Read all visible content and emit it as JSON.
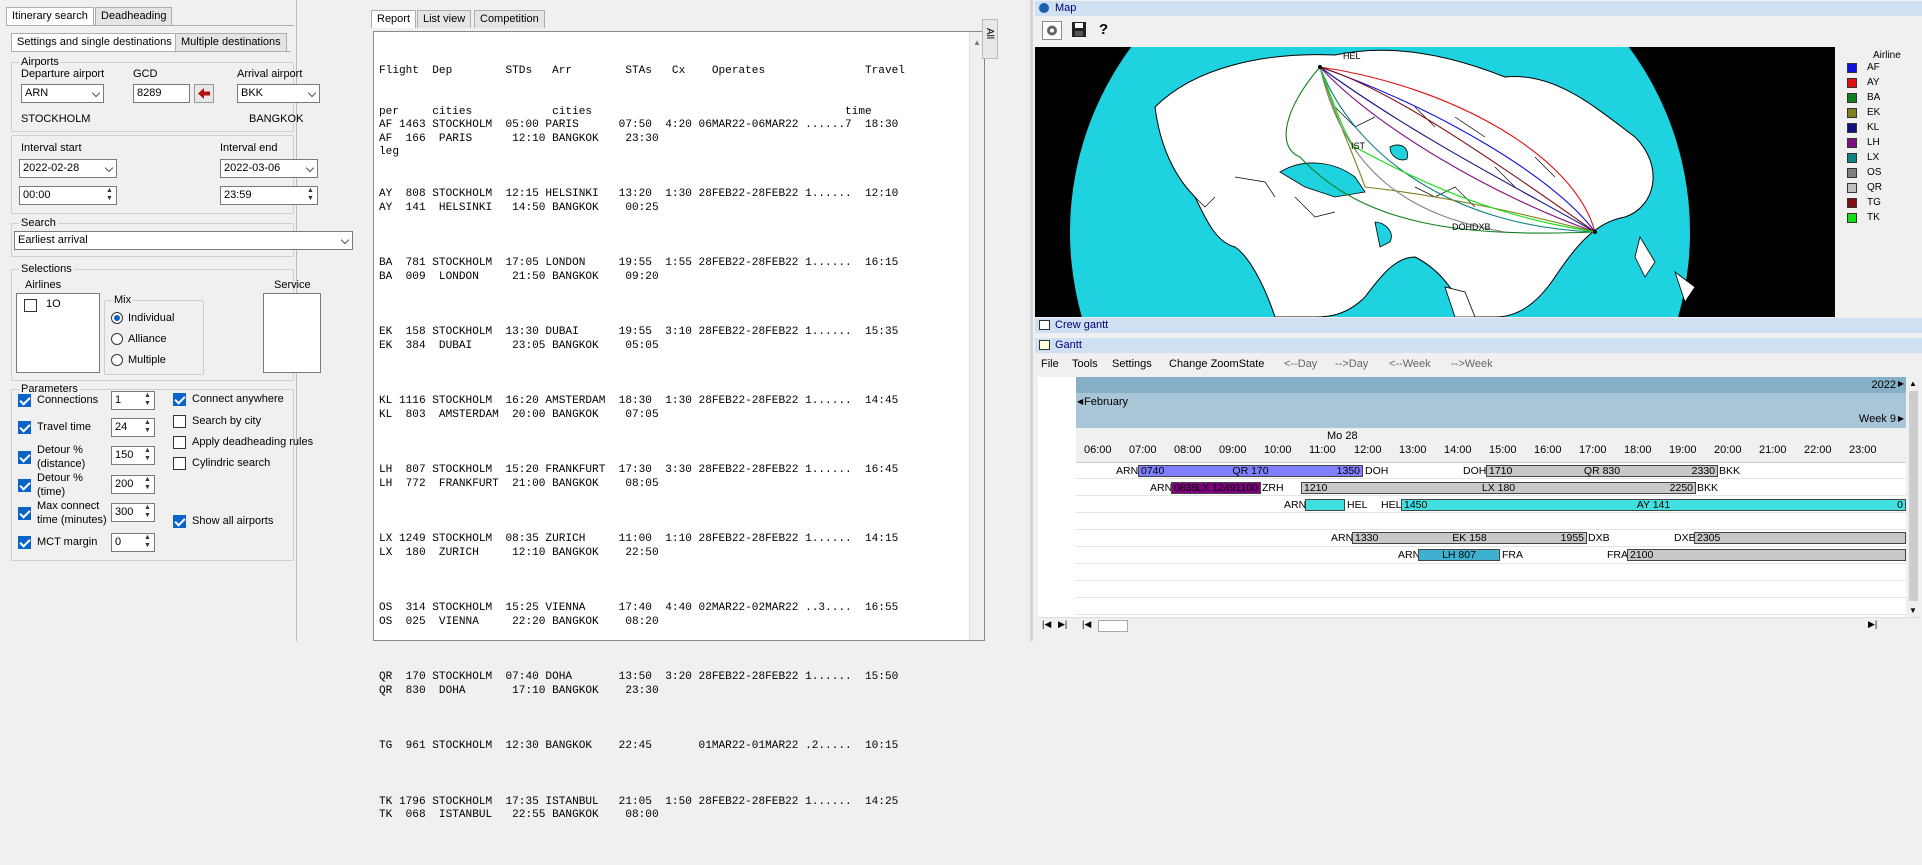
{
  "left_tabs": {
    "itinerary_search": "Itinerary search",
    "deadheading": "Deadheading"
  },
  "sub_tabs": {
    "settings": "Settings and single destinations",
    "multiple": "Multiple destinations"
  },
  "airports": {
    "legend": "Airports",
    "departure_label": "Departure airport",
    "departure_value": "ARN",
    "departure_city": "STOCKHOLM",
    "gcd_label": "GCD",
    "gcd_value": "8289",
    "arrival_label": "Arrival airport",
    "arrival_value": "BKK",
    "arrival_city": "BANGKOK"
  },
  "interval": {
    "start_label": "Interval start",
    "start_date": "2022-02-28",
    "start_time": "00:00",
    "end_label": "Interval end",
    "end_date": "2022-03-06",
    "end_time": "23:59"
  },
  "search": {
    "legend": "Search",
    "value": "Earliest arrival"
  },
  "selections": {
    "legend": "Selections",
    "airlines_label": "Airlines",
    "airline_item": "1O",
    "mix_label": "Mix",
    "mix_options": [
      "Individual",
      "Alliance",
      "Multiple"
    ],
    "service_label": "Service"
  },
  "parameters": {
    "legend": "Parameters",
    "connections": {
      "label": "Connections",
      "value": "1"
    },
    "travel_time": {
      "label": "Travel time",
      "value": "24"
    },
    "detour_distance": {
      "label1": "Detour %",
      "label2": "(distance)",
      "value": "150"
    },
    "detour_time": {
      "label1": "Detour %",
      "label2": "(time)",
      "value": "200"
    },
    "max_connect": {
      "label1": "Max connect",
      "label2": "time (minutes)",
      "value": "300"
    },
    "mct_margin": {
      "label": "MCT margin",
      "value": "0"
    },
    "connect_anywhere": "Connect anywhere",
    "search_by_city": "Search by city",
    "apply_deadheading": "Apply deadheading rules",
    "cylindric_search": "Cylindric search",
    "show_all_airports": "Show all airports"
  },
  "report_tabs": {
    "report": "Report",
    "list_view": "List view",
    "competition": "Competition"
  },
  "side_label": "All",
  "report": {
    "header": [
      "Flight  Dep        STDs   Arr        STAs   Cx    Operates               Travel",
      "per     cities            cities                                      time",
      "leg"
    ],
    "groups": [
      [
        "AF 1463 STOCKHOLM  05:00 PARIS      07:50  4:20 06MAR22-06MAR22 ......7  18:30",
        "AF  166  PARIS      12:10 BANGKOK    23:30"
      ],
      [
        "AY  808 STOCKHOLM  12:15 HELSINKI   13:20  1:30 28FEB22-28FEB22 1......  12:10",
        "AY  141  HELSINKI   14:50 BANGKOK    00:25"
      ],
      [
        "BA  781 STOCKHOLM  17:05 LONDON     19:55  1:55 28FEB22-28FEB22 1......  16:15",
        "BA  009  LONDON     21:50 BANGKOK    09:20"
      ],
      [
        "EK  158 STOCKHOLM  13:30 DUBAI      19:55  3:10 28FEB22-28FEB22 1......  15:35",
        "EK  384  DUBAI      23:05 BANGKOK    05:05"
      ],
      [
        "KL 1116 STOCKHOLM  16:20 AMSTERDAM  18:30  1:30 28FEB22-28FEB22 1......  14:45",
        "KL  803  AMSTERDAM  20:00 BANGKOK    07:05"
      ],
      [
        "LH  807 STOCKHOLM  15:20 FRANKFURT  17:30  3:30 28FEB22-28FEB22 1......  16:45",
        "LH  772  FRANKFURT  21:00 BANGKOK    08:05"
      ],
      [
        "LX 1249 STOCKHOLM  08:35 ZURICH     11:00  1:10 28FEB22-28FEB22 1......  14:15",
        "LX  180  ZURICH     12:10 BANGKOK    22:50"
      ],
      [
        "OS  314 STOCKHOLM  15:25 VIENNA     17:40  4:40 02MAR22-02MAR22 ..3....  16:55",
        "OS  025  VIENNA     22:20 BANGKOK    08:20"
      ],
      [
        "QR  170 STOCKHOLM  07:40 DOHA       13:50  3:20 28FEB22-28FEB22 1......  15:50",
        "QR  830  DOHA       17:10 BANGKOK    23:30"
      ],
      [
        "TG  961 STOCKHOLM  12:30 BANGKOK    22:45       01MAR22-01MAR22 .2.....  10:15"
      ],
      [
        "TK 1796 STOCKHOLM  17:35 ISTANBUL   21:05  1:50 28FEB22-28FEB22 1......  14:25",
        "TK  068  ISTANBUL   22:55 BANGKOK    08:00"
      ]
    ]
  },
  "map": {
    "title": "Map",
    "legend_title": "Airline",
    "airlines": [
      {
        "code": "AF",
        "color": "#1010e0"
      },
      {
        "code": "AY",
        "color": "#e01010"
      },
      {
        "code": "BA",
        "color": "#108020"
      },
      {
        "code": "EK",
        "color": "#808020"
      },
      {
        "code": "KL",
        "color": "#101080"
      },
      {
        "code": "LH",
        "color": "#801080"
      },
      {
        "code": "LX",
        "color": "#108080"
      },
      {
        "code": "OS",
        "color": "#808080"
      },
      {
        "code": "QR",
        "color": "#c0c0c0"
      },
      {
        "code": "TG",
        "color": "#801010"
      },
      {
        "code": "TK",
        "color": "#10e010"
      }
    ],
    "labels": {
      "hel": "HEL",
      "ist": "IST",
      "doh": "DOHDXB"
    }
  },
  "crew_gantt": {
    "title": "Crew gantt"
  },
  "gantt": {
    "title": "Gantt",
    "menu": [
      "File",
      "Tools",
      "Settings",
      "Change ZoomState",
      "<--Day",
      "-->Day",
      "<--Week",
      "-->Week"
    ],
    "year": "2022",
    "month": "February",
    "week": "Week 9",
    "day": "Mo 28",
    "hours": [
      "06:00",
      "07:00",
      "08:00",
      "09:00",
      "10:00",
      "11:00",
      "12:00",
      "13:00",
      "14:00",
      "15:00",
      "16:00",
      "17:00",
      "18:00",
      "19:00",
      "20:00",
      "21:00",
      "22:00",
      "23:00"
    ],
    "rows": [
      {
        "items": [
          {
            "kind": "label",
            "text": "ARN",
            "pos": "l1"
          },
          {
            "kind": "bar",
            "color": "#8080ff",
            "start": "0740",
            "flight": "QR  170",
            "end": "1350",
            "pos": "b1"
          },
          {
            "kind": "label",
            "text": "DOH",
            "pos": "l2"
          },
          {
            "kind": "label",
            "text": "DOH",
            "pos": "l3"
          },
          {
            "kind": "bar",
            "color": "#c8c8c8",
            "start": "1710",
            "flight": "QR  830",
            "end": "2330",
            "pos": "b2"
          },
          {
            "kind": "label",
            "text": "BKK",
            "pos": "l4"
          }
        ]
      },
      {
        "items": [
          {
            "kind": "label",
            "text": "ARN",
            "pos": "l5"
          },
          {
            "kind": "bar",
            "color": "#800080",
            "start": "0835",
            "flight": "LX 1249",
            "end": "1100",
            "pos": "b3"
          },
          {
            "kind": "label",
            "text": "ZRH",
            "pos": "l6"
          },
          {
            "kind": "bar",
            "color": "#c8c8c8",
            "start": "1210",
            "flight": "LX  180",
            "end": "2250",
            "pos": "b4"
          },
          {
            "kind": "label",
            "text": "BKK",
            "pos": "l7"
          }
        ]
      },
      {
        "items": [
          {
            "kind": "label",
            "text": "ARN",
            "pos": "l8"
          },
          {
            "kind": "bar",
            "color": "#40e0e0",
            "start": "",
            "flight": "",
            "end": "",
            "pos": "b5"
          },
          {
            "kind": "label",
            "text": "HEL",
            "pos": "l9"
          },
          {
            "kind": "label",
            "text": "HEL",
            "pos": "l10"
          },
          {
            "kind": "bar",
            "color": "#40e0e0",
            "start": "1450",
            "flight": "AY  141",
            "end": "0",
            "pos": "b6"
          }
        ]
      },
      {
        "items": [
          {
            "kind": "label",
            "text": "ARN",
            "pos": "l11"
          },
          {
            "kind": "bar",
            "color": "#c8c8c8",
            "start": "1330",
            "flight": "EK  158",
            "end": "1955",
            "pos": "b7"
          },
          {
            "kind": "label",
            "text": "DXB",
            "pos": "l12"
          },
          {
            "kind": "label",
            "text": "DXB",
            "pos": "l13"
          },
          {
            "kind": "bar",
            "color": "#c8c8c8",
            "start": "2305",
            "flight": "",
            "end": "",
            "pos": "b8"
          }
        ]
      },
      {
        "items": [
          {
            "kind": "label",
            "text": "ARN",
            "pos": "l14"
          },
          {
            "kind": "bar",
            "color": "#40b0d0",
            "start": "",
            "flight": "LH  807",
            "end": "",
            "pos": "b9"
          },
          {
            "kind": "label",
            "text": "FRA",
            "pos": "l15"
          },
          {
            "kind": "label",
            "text": "FRA",
            "pos": "l16"
          },
          {
            "kind": "bar",
            "color": "#c8c8c8",
            "start": "2100",
            "flight": "",
            "end": "",
            "pos": "b10"
          }
        ]
      }
    ]
  }
}
